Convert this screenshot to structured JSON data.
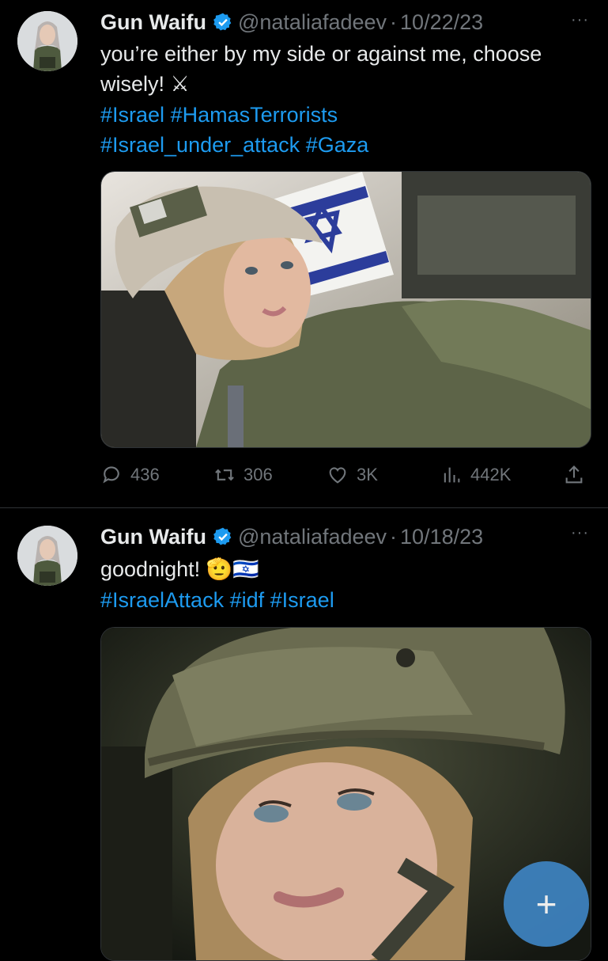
{
  "tweets": [
    {
      "name": "Gun Waifu",
      "handle": "@nataliafadeev",
      "separator": "·",
      "date": "10/22/23",
      "text_line1": "you’re either by my side or against me, choose",
      "text_line2": "wisely!",
      "text_emoji": "⚔",
      "hashtags_line1": [
        "#Israel",
        "#HamasTerrorists"
      ],
      "hashtags_line2": [
        "#Israel_under_attack",
        "#Gaza"
      ],
      "stats": {
        "replies": "436",
        "reposts": "306",
        "likes": "3K",
        "views": "442K"
      }
    },
    {
      "name": "Gun Waifu",
      "handle": "@nataliafadeev",
      "separator": "·",
      "date": "10/18/23",
      "text_line1": "goodnight!",
      "text_emoji": "🫡🇮🇱",
      "hashtags_line1": [
        "#IsraelAttack",
        "#idf",
        "#Israel"
      ]
    }
  ],
  "more_label": "···",
  "fab_label": "+",
  "colors": {
    "background": "#000000",
    "text": "#e7e9ea",
    "muted": "#71767b",
    "link": "#1d9bf0",
    "verified": "#1d9bf0",
    "fab": "#3e84c2"
  },
  "icons": [
    "reply-icon",
    "retweet-icon",
    "like-icon",
    "views-icon",
    "share-icon",
    "verified-icon",
    "more-icon",
    "compose-icon"
  ]
}
